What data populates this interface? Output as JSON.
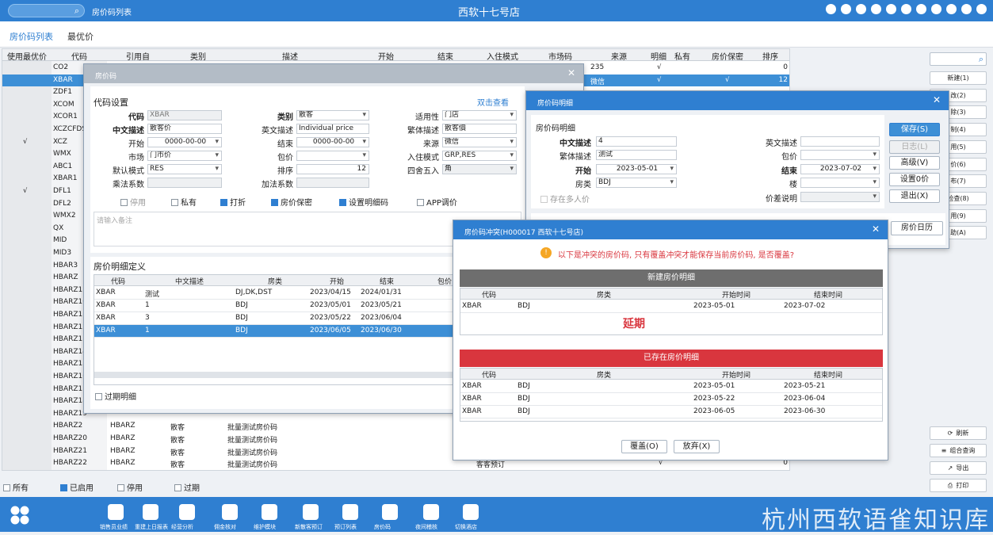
{
  "topbar": {
    "title": "房价码列表",
    "store": "西软十七号店"
  },
  "tabs": [
    "房价码列表",
    "最优价"
  ],
  "grid": {
    "headers": [
      "使用最优价",
      "代码",
      "引用自",
      "类别",
      "描述",
      "开始",
      "结束",
      "入住模式",
      "市场码",
      "来源",
      "明细",
      "私有",
      "房价保密",
      "排序"
    ],
    "top_rows": [
      {
        "check": "",
        "code": "CO2",
        "src": "235",
        "detail": "√",
        "sort": "0"
      },
      {
        "check": "",
        "code": "XBAR",
        "src": "微信",
        "detail": "√",
        "secret": "√",
        "sort": "12",
        "selected": true
      }
    ],
    "codes": [
      "ZDF1",
      "XCOM",
      "XCOR1",
      "XCZCFDS",
      "XCZ",
      "WMX",
      "ABC1",
      "XBAR1",
      "DFL1",
      "DFL2",
      "WMX2",
      "QX",
      "MID",
      "MID3",
      "HBAR3",
      "HBARZ",
      "HBARZ1",
      "HBARZ10",
      "HBARZ11",
      "HBARZ12",
      "HBARZ13",
      "HBARZ14",
      "HBARZ15",
      "HBARZ16",
      "HBARZ17",
      "HBARZ18",
      "HBARZ19"
    ],
    "checks": {
      "XCZ": "√",
      "DFL1": "√"
    },
    "bottom_rows": [
      {
        "code": "HBARZ2",
        "ref": "HBARZ",
        "cat": "散客",
        "desc": "批量测试房价码"
      },
      {
        "code": "HBARZ20",
        "ref": "HBARZ",
        "cat": "散客",
        "desc": "批量测试房价码"
      },
      {
        "code": "HBARZ21",
        "ref": "HBARZ",
        "cat": "散客",
        "desc": "批量测试房价码"
      },
      {
        "code": "HBARZ22",
        "ref": "HBARZ",
        "cat": "散客",
        "desc": "批量测试房价码",
        "src": "客客预订",
        "detail": "√",
        "sort": "0"
      }
    ]
  },
  "rtool": {
    "top_buttons": [
      "新建(1)",
      "改(2)",
      "除(3)",
      "制(4)",
      "用(5)",
      "价(6)",
      "布(7)",
      "检查(8)",
      "用(9)",
      "助(A)"
    ],
    "bottom_buttons": [
      "刷新",
      "组合查询",
      "导出",
      "打印"
    ]
  },
  "filterbar": {
    "items": [
      {
        "label": "所有",
        "on": false
      },
      {
        "label": "已启用",
        "on": true
      },
      {
        "label": "停用",
        "on": false
      },
      {
        "label": "过期",
        "on": false
      }
    ]
  },
  "dock": {
    "items": [
      "销售员业绩",
      "重建上日报表",
      "经营分析",
      "佣金核对",
      "维护模块",
      "新散客预订",
      "预订列表",
      "房价码",
      "夜间稽核",
      "切换酒店"
    ],
    "watermark": "杭州西软语雀知识库"
  },
  "dlg1": {
    "title": "房价码",
    "section": "代码设置",
    "link": "双击查看",
    "labels": {
      "code": "代码",
      "cname": "中文描述",
      "start": "开始",
      "market": "市场",
      "mode": "默认模式",
      "mult": "乘法系数",
      "cat": "类别",
      "ename": "英文描述",
      "end": "结束",
      "pack": "包价",
      "sort": "排序",
      "add": "加法系数",
      "apply": "适用性",
      "tname": "繁体描述",
      "source": "来源",
      "checkin": "入住模式",
      "round": "四舍五入"
    },
    "values": {
      "code": "XBAR",
      "cname": "散客价",
      "start": "0000-00-00",
      "market": "门市价",
      "mode": "RES",
      "cat": "散客",
      "ename": "Individual price",
      "end": "0000-00-00",
      "sort": "12",
      "apply": "门店",
      "tname": "散客價",
      "source": "微信",
      "checkin": "GRP,RES",
      "round": "角"
    },
    "checks": [
      {
        "label": "停用",
        "on": false,
        "dis": true
      },
      {
        "label": "私有",
        "on": false
      },
      {
        "label": "打折",
        "on": true
      },
      {
        "label": "房价保密",
        "on": true
      },
      {
        "label": "设置明细码",
        "on": true
      },
      {
        "label": "APP调价",
        "on": false
      }
    ],
    "remark_placeholder": "请输入备注",
    "detail_section": "房价明细定义",
    "detail_headers": [
      "代码",
      "中文描述",
      "房类",
      "开始",
      "结束",
      "包价"
    ],
    "detail_rows": [
      {
        "code": "XBAR",
        "name": "测试",
        "room": "DJ,DK,DST",
        "start": "2023/04/15",
        "end": "2024/01/31"
      },
      {
        "code": "XBAR",
        "name": "1",
        "room": "BDJ",
        "start": "2023/05/01",
        "end": "2023/05/21"
      },
      {
        "code": "XBAR",
        "name": "3",
        "room": "BDJ",
        "start": "2023/05/22",
        "end": "2023/06/04"
      },
      {
        "code": "XBAR",
        "name": "1",
        "room": "BDJ",
        "start": "2023/06/05",
        "end": "2023/06/30",
        "selected": true
      }
    ],
    "expired_label": "过期明细"
  },
  "dlg2": {
    "title": "房价码明细",
    "section": "房价码明细",
    "labels": {
      "cname": "中文描述",
      "tname": "繁体描述",
      "start": "开始",
      "room": "房类",
      "ename": "英文描述",
      "pack": "包价",
      "end": "结束",
      "floor": "楼",
      "diff": "价差说明",
      "multi": "存在多人价"
    },
    "values": {
      "cname": "4",
      "tname": "测试",
      "start": "2023-05-01",
      "room": "BDJ",
      "end": "2023-07-02"
    },
    "buttons": [
      "保存(S)",
      "日志(L)",
      "高级(V)",
      "设置0价",
      "退出(X)"
    ],
    "calendar": "房价日历"
  },
  "dlg3": {
    "title": "房价码冲突(H000017 西软十七号店)",
    "warning": "以下是冲突的房价码, 只有覆盖冲突才能保存当前房价码, 是否覆盖?",
    "new_header": "新建房价明细",
    "exist_header": "已存在房价明细",
    "cols": [
      "代码",
      "房类",
      "开始时间",
      "结束时间"
    ],
    "new_rows": [
      {
        "code": "XBAR",
        "room": "BDJ",
        "start": "2023-05-01",
        "end": "2023-07-02"
      }
    ],
    "extend": "延期",
    "exist_rows": [
      {
        "code": "XBAR",
        "room": "BDJ",
        "start": "2023-05-01",
        "end": "2023-05-21"
      },
      {
        "code": "XBAR",
        "room": "BDJ",
        "start": "2023-05-22",
        "end": "2023-06-04"
      },
      {
        "code": "XBAR",
        "room": "BDJ",
        "start": "2023-06-05",
        "end": "2023-06-30"
      }
    ],
    "overwrite": "覆盖(O)",
    "abandon": "放弃(X)"
  },
  "colors": {
    "accent": "#2f7fd1",
    "danger": "#d9363e",
    "dark": "#6e6e6e",
    "warn": "#f5a623"
  }
}
